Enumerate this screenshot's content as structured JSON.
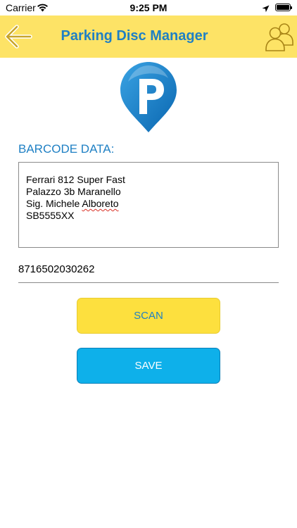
{
  "status_bar": {
    "carrier": "Carrier",
    "time": "9:25 PM",
    "wifi_icon": "wifi-icon",
    "location_icon": "location-arrow-icon",
    "battery_icon": "battery-icon",
    "battery_level": 1.0
  },
  "header": {
    "title": "Parking Disc Manager",
    "back_icon": "back-arrow-icon",
    "users_icon": "users-icon",
    "background_color": "#fde366",
    "title_color": "#1f80c4"
  },
  "logo": {
    "icon": "parking-pin-icon",
    "letter": "P",
    "color": "#1f80c4"
  },
  "barcode": {
    "label": "BARCODE DATA:",
    "lines": {
      "l1": "Ferrari 812 Super Fast",
      "l2": "Palazzo 3b Maranello",
      "l3a": "Sig. Michele ",
      "l3b": "Alboreto",
      "l4": "SB5555XX"
    },
    "code": "8716502030262"
  },
  "buttons": {
    "scan_label": "SCAN",
    "save_label": "SAVE",
    "scan_color": "#fde03e",
    "save_color": "#0eb0ea"
  }
}
